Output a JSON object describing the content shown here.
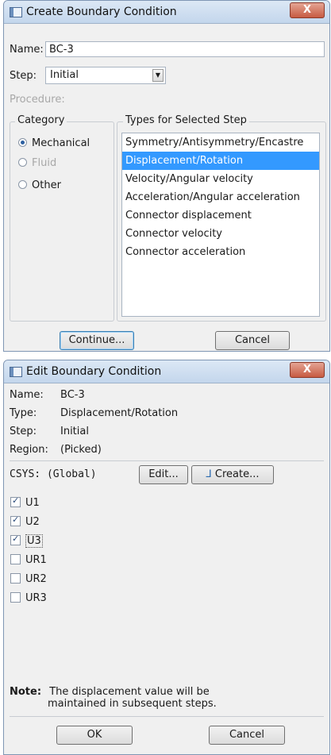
{
  "create_dialog": {
    "title": "Create Boundary Condition",
    "close_glyph": "X",
    "name_label": "Name:",
    "name_value": "BC-3",
    "step_label": "Step:",
    "step_value": "Initial",
    "procedure_label": "Procedure:",
    "category_title": "Category",
    "categories": [
      "Mechanical",
      "Fluid",
      "Other"
    ],
    "types_title": "Types for Selected Step",
    "types": [
      "Symmetry/Antisymmetry/Encastre",
      "Displacement/Rotation",
      "Velocity/Angular velocity",
      "Acceleration/Angular acceleration",
      "Connector displacement",
      "Connector velocity",
      "Connector acceleration"
    ],
    "continue_label": "Continue...",
    "cancel_label": "Cancel"
  },
  "edit_dialog": {
    "title": "Edit Boundary Condition",
    "close_glyph": "X",
    "name_label": "Name:",
    "name_value": "BC-3",
    "type_label": "Type:",
    "type_value": "Displacement/Rotation",
    "step_label": "Step:",
    "step_value": "Initial",
    "region_label": "Region:",
    "region_value": "(Picked)",
    "csys_label": "CSYS:",
    "csys_value": "(Global)",
    "edit_label": "Edit...",
    "create_label": "Create...",
    "dofs": [
      {
        "label": "U1",
        "checked": true
      },
      {
        "label": "U2",
        "checked": true
      },
      {
        "label": "U3",
        "checked": true
      },
      {
        "label": "UR1",
        "checked": false
      },
      {
        "label": "UR2",
        "checked": false
      },
      {
        "label": "UR3",
        "checked": false
      }
    ],
    "note_label": "Note:",
    "note_line1": "The displacement value will be",
    "note_line2": "maintained in subsequent steps.",
    "ok_label": "OK",
    "cancel_label": "Cancel"
  }
}
